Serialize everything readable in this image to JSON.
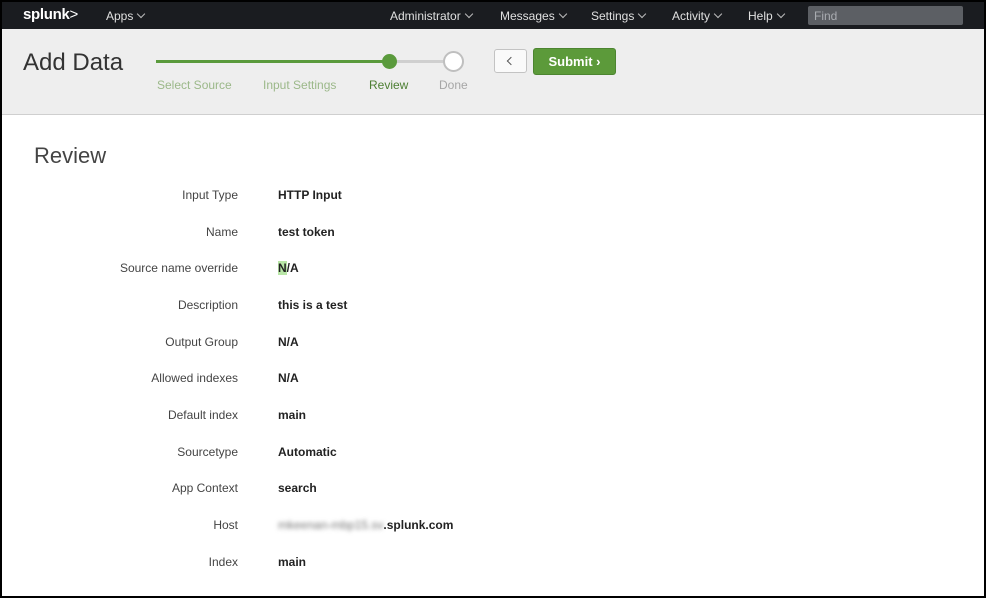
{
  "topbar": {
    "logo": "splunk",
    "logo_suffix": ">",
    "apps_label": "Apps",
    "menu": [
      {
        "label": "Administrator"
      },
      {
        "label": "Messages"
      },
      {
        "label": "Settings"
      },
      {
        "label": "Activity"
      },
      {
        "label": "Help"
      }
    ],
    "search_placeholder": "Find"
  },
  "header": {
    "title": "Add Data",
    "steps": [
      {
        "label": "Select Source",
        "state": "done"
      },
      {
        "label": "Input Settings",
        "state": "done"
      },
      {
        "label": "Review",
        "state": "current"
      },
      {
        "label": "Done",
        "state": "todo"
      }
    ],
    "submit_label": "Submit ›"
  },
  "review": {
    "title": "Review",
    "rows": [
      {
        "label": "Input Type",
        "value": "HTTP Input"
      },
      {
        "label": "Name",
        "value": "test token"
      },
      {
        "label": "Source name override",
        "value_highlight": "N",
        "value": "/A"
      },
      {
        "label": "Description",
        "value": "this is a test"
      },
      {
        "label": "Output Group",
        "value": "N/A"
      },
      {
        "label": "Allowed indexes",
        "value": "N/A"
      },
      {
        "label": "Default index",
        "value": "main"
      },
      {
        "label": "Sourcetype",
        "value": "Automatic"
      },
      {
        "label": "App Context",
        "value": "search"
      },
      {
        "label": "Host",
        "value_blurred": "mkeenan-mbp15.sv",
        "value": ".splunk.com"
      },
      {
        "label": "Index",
        "value": "main"
      }
    ]
  },
  "colors": {
    "accent": "#5c9a3a",
    "topbar": "#1a1c20",
    "header": "#eeeeee"
  }
}
